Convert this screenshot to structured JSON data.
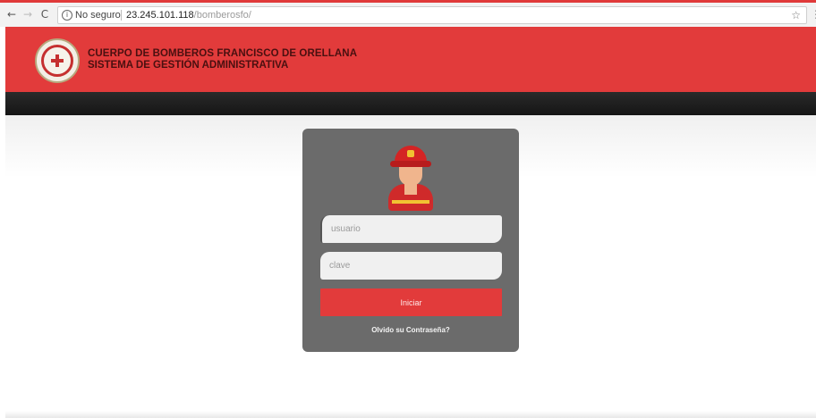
{
  "browser": {
    "security_label": "No seguro",
    "url_host": "23.245.101.118",
    "url_path": "/bomberosfo/"
  },
  "header": {
    "title": "CUERPO DE BOMBEROS FRANCISCO DE ORELLANA",
    "subtitle": "SISTEMA DE GESTIÓN ADMINISTRATIVA"
  },
  "login": {
    "username_placeholder": "usuario",
    "password_placeholder": "clave",
    "submit_label": "Iniciar",
    "forgot_label": "Olvido su Contraseña?"
  },
  "colors": {
    "brand_red": "#e23b3b",
    "card_gray": "#6b6b6b",
    "dark_band": "#1f1f1f"
  },
  "icons": [
    "back-icon",
    "forward-icon",
    "reload-icon",
    "info-icon",
    "star-icon",
    "firefighter-avatar-icon",
    "fire-department-logo"
  ]
}
